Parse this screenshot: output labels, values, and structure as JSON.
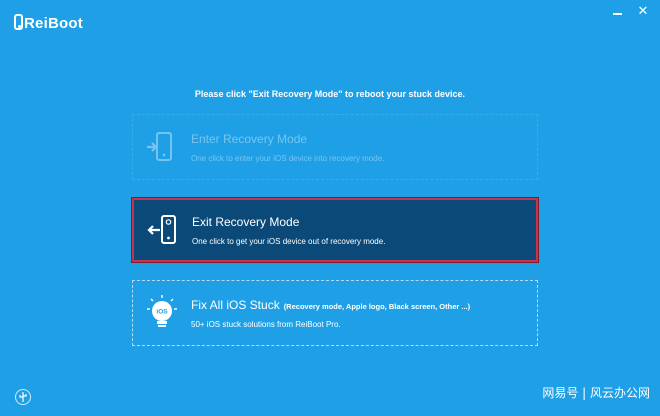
{
  "app": {
    "logo_text": "ReiBoot"
  },
  "window_controls": {
    "minimize_icon": "minimize-icon",
    "close_glyph": "✕"
  },
  "instruction": "Please click \"Exit Recovery Mode\" to reboot your stuck device.",
  "options": {
    "enter": {
      "title": "Enter Recovery Mode",
      "description": "One click to enter your iOS device into recovery mode.",
      "enabled": false
    },
    "exit": {
      "title": "Exit Recovery Mode",
      "description": "One click to get your iOS device out of recovery mode.",
      "selected": true
    },
    "fix": {
      "title": "Fix All iOS Stuck",
      "detail": "(Recovery mode, Apple logo, Black screen, Other ...)",
      "description": "50+ iOS stuck solutions from ReiBoot Pro.",
      "badge": "iOS"
    }
  },
  "footer": {
    "usb_icon": "usb-icon",
    "watermark": "网易号 | 风云办公网"
  },
  "colors": {
    "background": "#1fa0e6",
    "selected_fill": "#0b4a78",
    "selected_border": "#c8324d"
  }
}
